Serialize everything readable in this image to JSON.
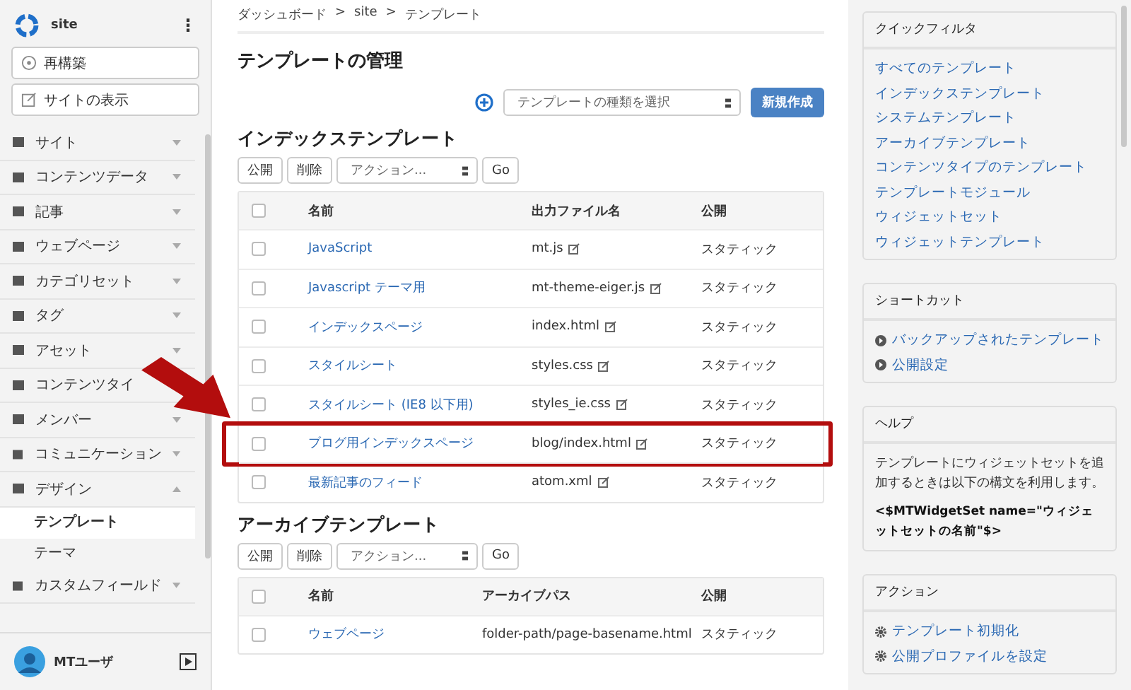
{
  "sidebar": {
    "site_name": "site",
    "menu_glyph": "⋮",
    "buttons": [
      "再構築",
      "サイトの表示"
    ],
    "items": [
      {
        "label": "サイト",
        "expanded": false
      },
      {
        "label": "コンテンツデータ",
        "expanded": false
      },
      {
        "label": "記事",
        "expanded": false
      },
      {
        "label": "ウェブページ",
        "expanded": false
      },
      {
        "label": "カテゴリセット",
        "expanded": false
      },
      {
        "label": "タグ",
        "expanded": false
      },
      {
        "label": "アセット",
        "expanded": false
      },
      {
        "label": "コンテンツタイ"
      },
      {
        "label": "メンバー",
        "expanded": false
      },
      {
        "label": "コミュニケーション",
        "expanded": false
      },
      {
        "label": "デザイン",
        "expanded": true,
        "children": [
          {
            "label": "テンプレート",
            "selected": true
          },
          {
            "label": "テーマ",
            "selected": false
          }
        ]
      },
      {
        "label": "カスタムフィールド",
        "expanded": false
      }
    ],
    "user": "MTユーザ"
  },
  "breadcrumb": [
    "ダッシュボード",
    "site",
    "テンプレート"
  ],
  "breadcrumb_separator": ">",
  "title": "テンプレートの管理",
  "template_type_select": {
    "placeholder": "テンプレートの種類を選択"
  },
  "create_button": "新規作成",
  "sections": [
    {
      "heading": "インデックステンプレート",
      "buttons": [
        "公開",
        "削除"
      ],
      "action_select": "アクション...",
      "go": "Go",
      "all_checked": false,
      "columns": [
        "名前",
        "出力ファイル名",
        "公開"
      ],
      "rows": [
        {
          "name": "JavaScript",
          "path": "mt.js",
          "publish": "スタティック",
          "checked": false,
          "highlighted": false,
          "external": true
        },
        {
          "name": "Javascript テーマ用",
          "path": "mt-theme-eiger.js",
          "publish": "スタティック",
          "checked": false,
          "highlighted": false,
          "external": true
        },
        {
          "name": "インデックスページ",
          "path": "index.html",
          "publish": "スタティック",
          "checked": false,
          "highlighted": false,
          "external": true
        },
        {
          "name": "スタイルシート",
          "path": "styles.css",
          "publish": "スタティック",
          "checked": false,
          "highlighted": false,
          "external": true
        },
        {
          "name": "スタイルシート (IE8 以下用)",
          "path": "styles_ie.css",
          "publish": "スタティック",
          "checked": false,
          "highlighted": false,
          "external": true
        },
        {
          "name": "ブログ用インデックスページ",
          "path": "blog/index.html",
          "publish": "スタティック",
          "checked": false,
          "highlighted": true,
          "external": true
        },
        {
          "name": "最新記事のフィード",
          "path": "atom.xml",
          "publish": "スタティック",
          "checked": false,
          "highlighted": false,
          "external": true
        }
      ]
    },
    {
      "heading": "アーカイブテンプレート",
      "buttons": [
        "公開",
        "削除"
      ],
      "action_select": "アクション...",
      "go": "Go",
      "all_checked": false,
      "columns": [
        "名前",
        "アーカイブパス",
        "公開"
      ],
      "rows": [
        {
          "name": "ウェブページ",
          "path": "folder-path/page-basename.html",
          "publish": "スタティック",
          "checked": false,
          "highlighted": false,
          "external": false
        }
      ]
    }
  ],
  "widgets": [
    {
      "kind": "links",
      "title": "クイックフィルタ",
      "links": [
        "すべてのテンプレート",
        "インデックステンプレート",
        "システムテンプレート",
        "アーカイブテンプレート",
        "コンテンツタイプのテンプレート",
        "テンプレートモジュール",
        "ウィジェットセット",
        "ウィジェットテンプレート"
      ]
    },
    {
      "kind": "shortcuts",
      "title": "ショートカット",
      "links": [
        "バックアップされたテンプレート",
        "公開設定"
      ]
    },
    {
      "kind": "help",
      "title": "ヘルプ",
      "text": "テンプレートにウィジェットセットを追加するときは以下の構文を利用します。",
      "code": "<$MTWidgetSet name=\"ウィジェットセットの名前\"$>"
    },
    {
      "kind": "actions",
      "title": "アクション",
      "links": [
        "テンプレート初期化",
        "公開プロファイルを設定"
      ]
    }
  ]
}
